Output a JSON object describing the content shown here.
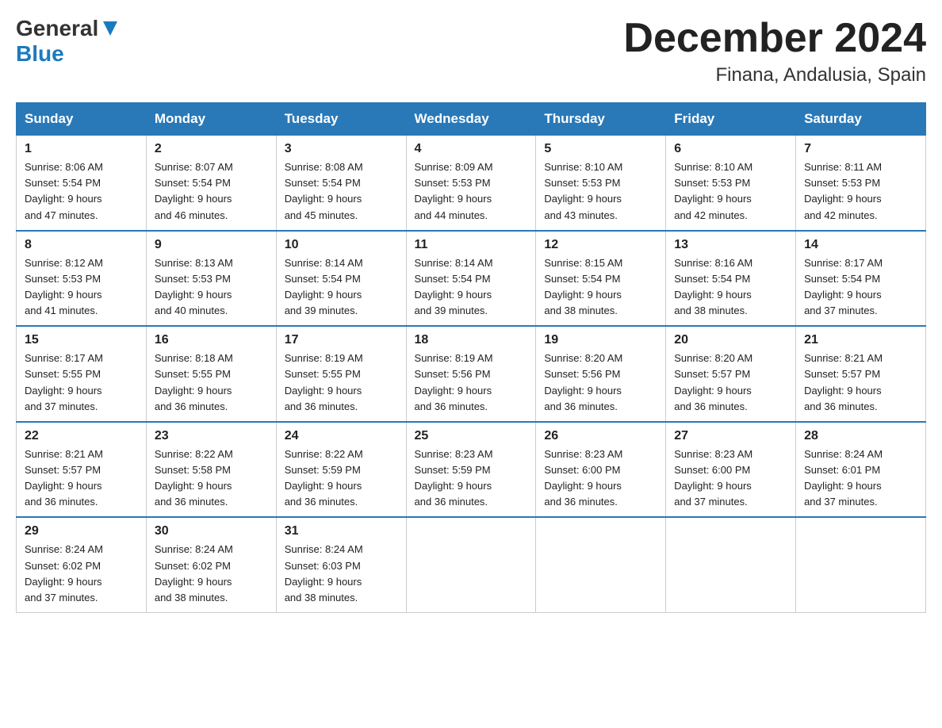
{
  "header": {
    "logo_general": "General",
    "logo_blue": "Blue",
    "title": "December 2024",
    "location": "Finana, Andalusia, Spain"
  },
  "weekdays": [
    "Sunday",
    "Monday",
    "Tuesday",
    "Wednesday",
    "Thursday",
    "Friday",
    "Saturday"
  ],
  "weeks": [
    [
      {
        "day": "1",
        "sunrise": "8:06 AM",
        "sunset": "5:54 PM",
        "daylight": "9 hours and 47 minutes."
      },
      {
        "day": "2",
        "sunrise": "8:07 AM",
        "sunset": "5:54 PM",
        "daylight": "9 hours and 46 minutes."
      },
      {
        "day": "3",
        "sunrise": "8:08 AM",
        "sunset": "5:54 PM",
        "daylight": "9 hours and 45 minutes."
      },
      {
        "day": "4",
        "sunrise": "8:09 AM",
        "sunset": "5:53 PM",
        "daylight": "9 hours and 44 minutes."
      },
      {
        "day": "5",
        "sunrise": "8:10 AM",
        "sunset": "5:53 PM",
        "daylight": "9 hours and 43 minutes."
      },
      {
        "day": "6",
        "sunrise": "8:10 AM",
        "sunset": "5:53 PM",
        "daylight": "9 hours and 42 minutes."
      },
      {
        "day": "7",
        "sunrise": "8:11 AM",
        "sunset": "5:53 PM",
        "daylight": "9 hours and 42 minutes."
      }
    ],
    [
      {
        "day": "8",
        "sunrise": "8:12 AM",
        "sunset": "5:53 PM",
        "daylight": "9 hours and 41 minutes."
      },
      {
        "day": "9",
        "sunrise": "8:13 AM",
        "sunset": "5:53 PM",
        "daylight": "9 hours and 40 minutes."
      },
      {
        "day": "10",
        "sunrise": "8:14 AM",
        "sunset": "5:54 PM",
        "daylight": "9 hours and 39 minutes."
      },
      {
        "day": "11",
        "sunrise": "8:14 AM",
        "sunset": "5:54 PM",
        "daylight": "9 hours and 39 minutes."
      },
      {
        "day": "12",
        "sunrise": "8:15 AM",
        "sunset": "5:54 PM",
        "daylight": "9 hours and 38 minutes."
      },
      {
        "day": "13",
        "sunrise": "8:16 AM",
        "sunset": "5:54 PM",
        "daylight": "9 hours and 38 minutes."
      },
      {
        "day": "14",
        "sunrise": "8:17 AM",
        "sunset": "5:54 PM",
        "daylight": "9 hours and 37 minutes."
      }
    ],
    [
      {
        "day": "15",
        "sunrise": "8:17 AM",
        "sunset": "5:55 PM",
        "daylight": "9 hours and 37 minutes."
      },
      {
        "day": "16",
        "sunrise": "8:18 AM",
        "sunset": "5:55 PM",
        "daylight": "9 hours and 36 minutes."
      },
      {
        "day": "17",
        "sunrise": "8:19 AM",
        "sunset": "5:55 PM",
        "daylight": "9 hours and 36 minutes."
      },
      {
        "day": "18",
        "sunrise": "8:19 AM",
        "sunset": "5:56 PM",
        "daylight": "9 hours and 36 minutes."
      },
      {
        "day": "19",
        "sunrise": "8:20 AM",
        "sunset": "5:56 PM",
        "daylight": "9 hours and 36 minutes."
      },
      {
        "day": "20",
        "sunrise": "8:20 AM",
        "sunset": "5:57 PM",
        "daylight": "9 hours and 36 minutes."
      },
      {
        "day": "21",
        "sunrise": "8:21 AM",
        "sunset": "5:57 PM",
        "daylight": "9 hours and 36 minutes."
      }
    ],
    [
      {
        "day": "22",
        "sunrise": "8:21 AM",
        "sunset": "5:57 PM",
        "daylight": "9 hours and 36 minutes."
      },
      {
        "day": "23",
        "sunrise": "8:22 AM",
        "sunset": "5:58 PM",
        "daylight": "9 hours and 36 minutes."
      },
      {
        "day": "24",
        "sunrise": "8:22 AM",
        "sunset": "5:59 PM",
        "daylight": "9 hours and 36 minutes."
      },
      {
        "day": "25",
        "sunrise": "8:23 AM",
        "sunset": "5:59 PM",
        "daylight": "9 hours and 36 minutes."
      },
      {
        "day": "26",
        "sunrise": "8:23 AM",
        "sunset": "6:00 PM",
        "daylight": "9 hours and 36 minutes."
      },
      {
        "day": "27",
        "sunrise": "8:23 AM",
        "sunset": "6:00 PM",
        "daylight": "9 hours and 37 minutes."
      },
      {
        "day": "28",
        "sunrise": "8:24 AM",
        "sunset": "6:01 PM",
        "daylight": "9 hours and 37 minutes."
      }
    ],
    [
      {
        "day": "29",
        "sunrise": "8:24 AM",
        "sunset": "6:02 PM",
        "daylight": "9 hours and 37 minutes."
      },
      {
        "day": "30",
        "sunrise": "8:24 AM",
        "sunset": "6:02 PM",
        "daylight": "9 hours and 38 minutes."
      },
      {
        "day": "31",
        "sunrise": "8:24 AM",
        "sunset": "6:03 PM",
        "daylight": "9 hours and 38 minutes."
      },
      null,
      null,
      null,
      null
    ]
  ],
  "labels": {
    "sunrise": "Sunrise:",
    "sunset": "Sunset:",
    "daylight": "Daylight:"
  }
}
